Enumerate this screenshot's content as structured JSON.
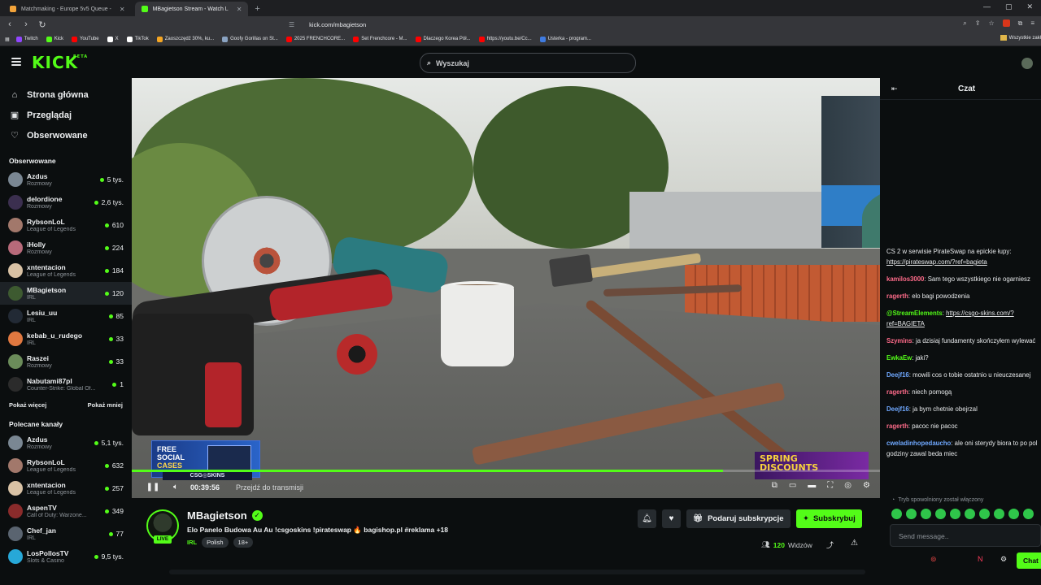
{
  "browser": {
    "tabs": [
      {
        "label": "Matchmaking - Europe 5v5 Queue -",
        "active": false
      },
      {
        "label": "MBagietson Stream - Watch L",
        "active": true
      }
    ],
    "url": "kick.com/mbagietson",
    "bookmarks": [
      {
        "label": "Twitch",
        "color": "#9146ff"
      },
      {
        "label": "Kick",
        "color": "#53fc18"
      },
      {
        "label": "YouTube",
        "color": "#ff0000"
      },
      {
        "label": "X",
        "color": "#ffffff"
      },
      {
        "label": "TikTok",
        "color": "#ffffff"
      },
      {
        "label": "Zaoszczędź 30%, ku...",
        "color": "#f5a623"
      },
      {
        "label": "Goofy Gorillas on St...",
        "color": "#8aa3c2"
      },
      {
        "label": "2025 FRENCHCORE...",
        "color": "#ff0000"
      },
      {
        "label": "Set Frenchcore - M...",
        "color": "#ff0000"
      },
      {
        "label": "Dlaczego Korea Pół...",
        "color": "#ff0000"
      },
      {
        "label": "https://youtu.be/Cc...",
        "color": "#ff0000"
      },
      {
        "label": "Usterka - program...",
        "color": "#3f7be0"
      }
    ],
    "bookmarks_right": "Wszystkie zakł"
  },
  "header": {
    "logo": "KICK",
    "logo_badge": "BETA",
    "search_placeholder": "Wyszukaj"
  },
  "sidebar": {
    "nav": [
      {
        "label": "Strona główna",
        "icon": "home-icon"
      },
      {
        "label": "Przeglądaj",
        "icon": "browse-icon"
      },
      {
        "label": "Obserwowane",
        "icon": "heart-icon"
      }
    ],
    "followed_title": "Obserwowane",
    "followed": [
      {
        "name": "Azdus",
        "category": "Rozmowy",
        "viewers": "5 tys.",
        "color": "#7a8793"
      },
      {
        "name": "delordione",
        "category": "Rozmowy",
        "viewers": "2,6 tys.",
        "color": "#3b2f4f"
      },
      {
        "name": "RybsonLoL",
        "category": "League of Legends",
        "viewers": "610",
        "color": "#a2786b"
      },
      {
        "name": "iHolly",
        "category": "Rozmowy",
        "viewers": "224",
        "color": "#b86a7a"
      },
      {
        "name": "xntentacion",
        "category": "League of Legends",
        "viewers": "184",
        "color": "#d9c2a5"
      },
      {
        "name": "MBagietson",
        "category": "IRL",
        "viewers": "120",
        "color": "#3d5a30",
        "active": true
      },
      {
        "name": "Lesiu_uu",
        "category": "IRL",
        "viewers": "85",
        "color": "#222a35"
      },
      {
        "name": "kebab_u_rudego",
        "category": "IRL",
        "viewers": "33",
        "color": "#e07840"
      },
      {
        "name": "Raszei",
        "category": "Rozmowy",
        "viewers": "33",
        "color": "#6b8c5a"
      },
      {
        "name": "Nabutami87pl",
        "category": "Counter-Strike: Global Of...",
        "viewers": "1",
        "color": "#2b2b2b"
      }
    ],
    "show_more": "Pokaż więcej",
    "show_less": "Pokaż mniej",
    "recommended_title": "Polecane kanały",
    "recommended": [
      {
        "name": "Azdus",
        "category": "Rozmowy",
        "viewers": "5,1 tys.",
        "color": "#7a8793"
      },
      {
        "name": "RybsonLoL",
        "category": "League of Legends",
        "viewers": "632",
        "color": "#a2786b"
      },
      {
        "name": "xntentacion",
        "category": "League of Legends",
        "viewers": "257",
        "color": "#d9c2a5"
      },
      {
        "name": "AspenTV",
        "category": "Call of Duty: Warzone...",
        "viewers": "349",
        "color": "#8a2b2b"
      },
      {
        "name": "Chef_jan",
        "category": "IRL",
        "viewers": "77",
        "color": "#5a6470"
      },
      {
        "name": "LosPollosTV",
        "category": "Slots & Casino",
        "viewers": "9,5 tys.",
        "color": "#27a8d8"
      }
    ]
  },
  "video": {
    "ad_left_line1": "FREE",
    "ad_left_line2": "SOCIAL",
    "ad_left_line3": "CASES",
    "ad_left_label": "CSG◎SKINS",
    "ad_right_line1": "SPRING",
    "ad_right_line2": "DISCOUNTS",
    "timecode": "00:39:56",
    "go_live": "Przejdź do transmisji",
    "progress": 0.79
  },
  "stream": {
    "name": "MBagietson",
    "live_label": "LIVE",
    "title": "Elo Panelo Budowa Au Au !csgoskins !pirateswap 🔥 bagishop.pl #reklama +18",
    "category": "IRL",
    "tags": [
      "Polish",
      "18+"
    ],
    "gift_label": "Podaruj subskrypcje",
    "subscribe_label": "Subskrybuj",
    "viewers_count": "120",
    "viewers_label": "Widzów"
  },
  "chat": {
    "title": "Czat",
    "messages": [
      {
        "user": "",
        "color": "#e6e8ea",
        "text": "CS 2 w serwisie PirateSwap na epickie łupy: ",
        "link": "https://pirateswap.com/?ref=bagieta"
      },
      {
        "user": "kamilos3000",
        "color": "#ff6b8a",
        "text": "Sam tego wszystkiego nie ogarniesz",
        "link": ""
      },
      {
        "user": "ragerth",
        "color": "#ff6b8a",
        "text": "elo bagi powodzenia",
        "link": ""
      },
      {
        "user": "@StreamElements",
        "color": "#53fc18",
        "text": "",
        "link": "https://csgo-skins.com/?ref=BAGIETA"
      },
      {
        "user": "Szymins",
        "color": "#ff6b8a",
        "text": "ja dzisiaj fundamenty skończyłem wylewać",
        "link": ""
      },
      {
        "user": "EwkaEw",
        "color": "#53fc18",
        "text": "jaki?",
        "link": ""
      },
      {
        "user": "Deejf16",
        "color": "#6fa8ff",
        "text": "mowili cos o tobie ostatnio u nieuczesanej",
        "link": ""
      },
      {
        "user": "ragerth",
        "color": "#ff6b8a",
        "text": "niech pomogą",
        "link": ""
      },
      {
        "user": "Deejf16",
        "color": "#6fa8ff",
        "text": "ja bym chetnie obejrzal",
        "link": ""
      },
      {
        "user": "ragerth",
        "color": "#ff6b8a",
        "text": "pacoc nie pacoc",
        "link": ""
      },
      {
        "user": "cweladinhopedaucho",
        "color": "#6fa8ff",
        "text": "ale oni sterydy biora to po pol godziny zawal beda miec",
        "link": ""
      }
    ],
    "slow_mode": "Tryb spowolniony został włączony",
    "input_placeholder": "Send message..",
    "chat_button": "Chat"
  }
}
